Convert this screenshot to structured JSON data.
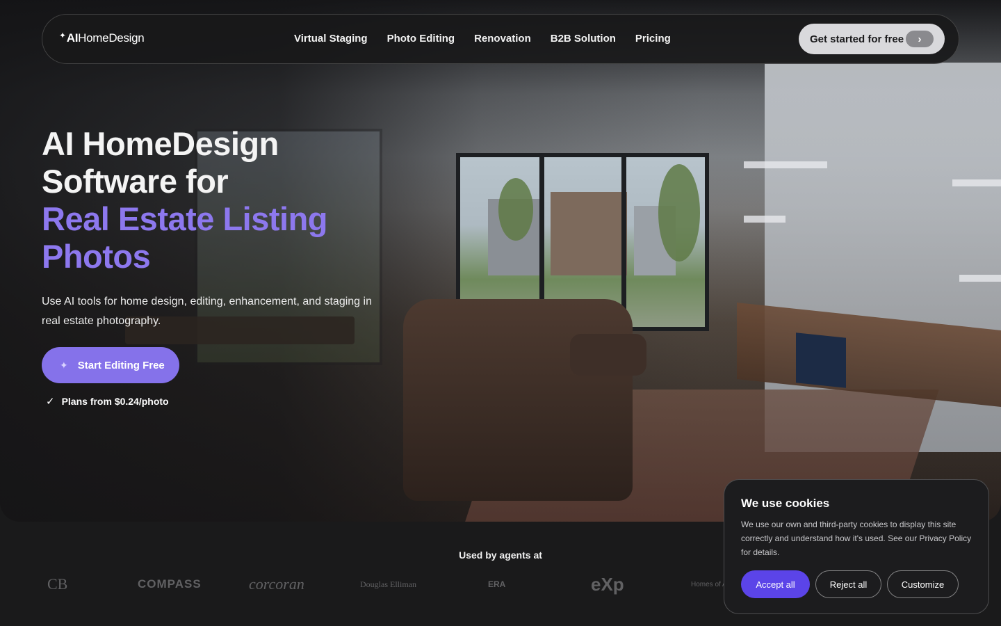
{
  "nav": {
    "logo_sparkle": "✦",
    "logo_ai": "AI",
    "logo_name": "HomeDesign",
    "links": [
      "Virtual Staging",
      "Photo Editing",
      "Renovation",
      "B2B Solution",
      "Pricing"
    ],
    "cta_label": "Get started for free",
    "cta_arrow": "›"
  },
  "hero": {
    "headline_line1": "AI HomeDesign",
    "headline_line2": "Software for",
    "headline_line3": "Real Estate Listing",
    "headline_line4": "Photos",
    "subtext": "Use AI tools for home design, editing, enhancement, and staging in real estate photography.",
    "cta_label": "Start Editing Free",
    "plans_text": "Plans from $0.24/photo"
  },
  "used_by": {
    "label": "Used by agents at",
    "brands": [
      "CB",
      "COMPASS",
      "corcoran",
      "Douglas Elliman",
      "ERA",
      "eXp",
      "Homes of America"
    ]
  },
  "cookie": {
    "title": "We use cookies",
    "text": "We use our own and third-party cookies to display this site correctly and understand how it's used. See our Privacy Policy for details.",
    "accept": "Accept all",
    "reject": "Reject all",
    "customize": "Customize"
  },
  "colors": {
    "accent_purple": "#8572ea",
    "headline_purple": "#8d78ee",
    "cookie_accept": "#5b44e8",
    "background": "#1a1a1b"
  }
}
